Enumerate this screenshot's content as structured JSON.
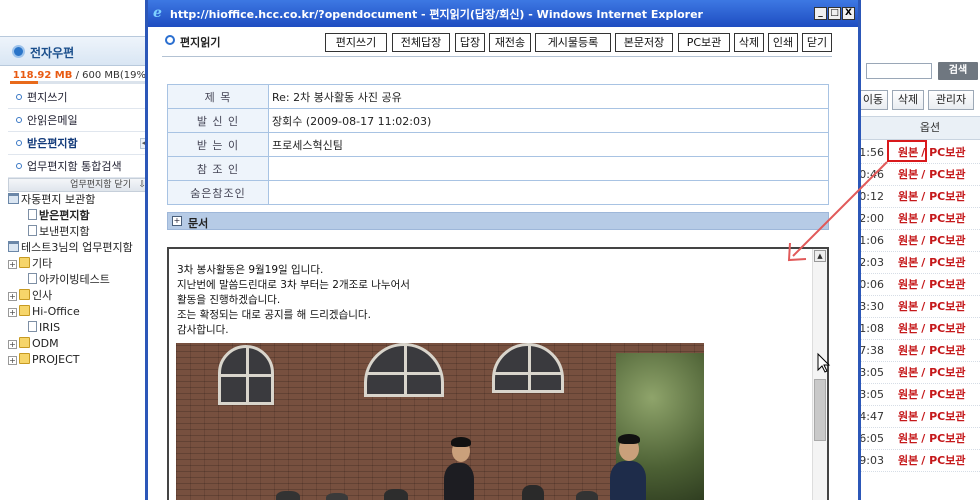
{
  "left_panel": {
    "title": "전자우편",
    "quota_used": "118.92 MB",
    "quota_rest": " / 600 MB(19%",
    "quota_fraction": 0.198,
    "nav": [
      {
        "label": "편지쓰기"
      },
      {
        "label": "안읽은메일"
      },
      {
        "label": "받은편지함"
      },
      {
        "label": "업무편지함 통합검색"
      }
    ],
    "tree_header": "업무편지함 닫기",
    "tree": [
      {
        "label": "자동편지 보관함"
      },
      {
        "label": "받은편지함"
      },
      {
        "label": "보낸편지함"
      },
      {
        "label": "테스트3님의 업무편지함"
      },
      {
        "label": "기타"
      },
      {
        "label": "아카이빙테스트"
      },
      {
        "label": "인사"
      },
      {
        "label": "Hi-Office"
      },
      {
        "label": "IRIS"
      },
      {
        "label": "ODM"
      },
      {
        "label": "PROJECT"
      }
    ]
  },
  "right_panel": {
    "search_button": "검색",
    "toolbar": [
      "이동",
      "삭제",
      "관리자"
    ],
    "column_header": "옵션",
    "rows": [
      {
        "time": "1:56",
        "orig": "원본",
        "pc": "/ PC보관"
      },
      {
        "time": "0:46",
        "orig": "원본",
        "pc": "/ PC보관"
      },
      {
        "time": "0:12",
        "orig": "원본",
        "pc": "/ PC보관"
      },
      {
        "time": "2:00",
        "orig": "원본",
        "pc": "/ PC보관"
      },
      {
        "time": "1:06",
        "orig": "원본",
        "pc": "/ PC보관"
      },
      {
        "time": "2:03",
        "orig": "원본",
        "pc": "/ PC보관"
      },
      {
        "time": "0:06",
        "orig": "원본",
        "pc": "/ PC보관"
      },
      {
        "time": "3:30",
        "orig": "원본",
        "pc": "/ PC보관"
      },
      {
        "time": "1:08",
        "orig": "원본",
        "pc": "/ PC보관"
      },
      {
        "time": "7:38",
        "orig": "원본",
        "pc": "/ PC보관"
      },
      {
        "time": "3:05",
        "orig": "원본",
        "pc": "/ PC보관"
      },
      {
        "time": "3:05",
        "orig": "원본",
        "pc": "/ PC보관"
      },
      {
        "time": "4:47",
        "orig": "원본",
        "pc": "/ PC보관"
      },
      {
        "time": "6:05",
        "orig": "원본",
        "pc": "/ PC보관"
      },
      {
        "time": "9:03",
        "orig": "원본",
        "pc": "/ PC보관"
      }
    ]
  },
  "popup": {
    "window_title": "http://hioffice.hcc.co.kr/?opendocument - 편지읽기(답장/회신) - Windows Internet Explorer",
    "window_buttons": {
      "minimize": "_",
      "maximize": "□",
      "close": "X"
    },
    "header_title": "편지읽기",
    "toolbar": [
      "편지쓰기",
      "전체답장",
      "답장",
      "재전송",
      "게시물등록",
      "본문저장",
      "PC보관",
      "삭제",
      "인쇄",
      "닫기"
    ],
    "fields": [
      {
        "label": "제  목",
        "value": "Re: 2차 봉사활동 사진 공유"
      },
      {
        "label": "발 신 인",
        "value": "장회수 (2009-08-17 11:02:03)"
      },
      {
        "label": "받 는 이",
        "value": "프로세스혁신팀"
      },
      {
        "label": "참 조 인",
        "value": ""
      },
      {
        "label": "숨은참조인",
        "value": ""
      }
    ],
    "section_title": "문서",
    "body_lines": [
      "3차 봉사활동은 9월19일 입니다.",
      "지난번에 말씀드린대로 3차 부터는 2개조로 나누어서",
      "활동을 진행하겠습니다.",
      "조는 확정되는 대로 공지를 해 드리겠습니다.",
      "감사합니다."
    ]
  },
  "colors": {
    "title_bar": "#2c57b8",
    "accent_red": "#c5181a",
    "label_bg": "#eef4fb",
    "border_blue": "#a8c3e3"
  }
}
